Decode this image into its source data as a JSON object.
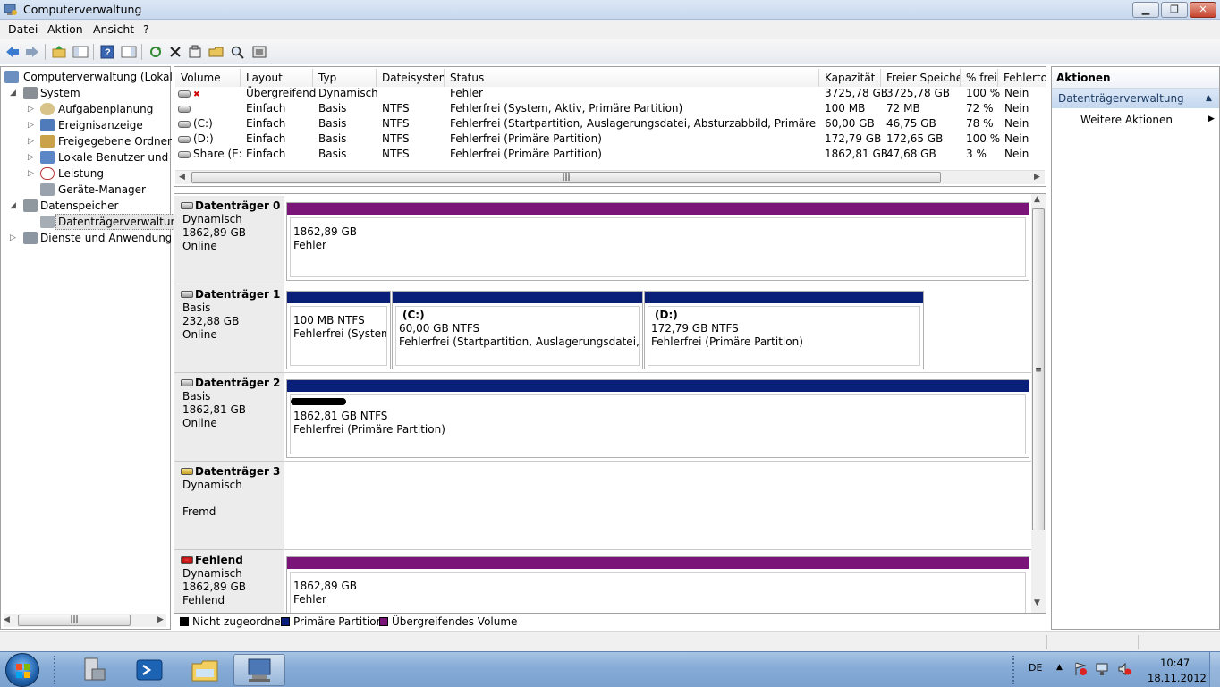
{
  "window": {
    "title": "Computerverwaltung"
  },
  "menu": [
    "Datei",
    "Aktion",
    "Ansicht",
    "?"
  ],
  "tree": [
    {
      "label": "Computerverwaltung (Lokal)"
    },
    {
      "label": "System"
    },
    {
      "label": "Aufgabenplanung"
    },
    {
      "label": "Ereignisanzeige"
    },
    {
      "label": "Freigegebene Ordner"
    },
    {
      "label": "Lokale Benutzer und Gru"
    },
    {
      "label": "Leistung"
    },
    {
      "label": "Geräte-Manager"
    },
    {
      "label": "Datenspeicher"
    },
    {
      "label": "Datenträgerverwaltung"
    },
    {
      "label": "Dienste und Anwendungen"
    }
  ],
  "volumes": {
    "columns": [
      "Volume",
      "Layout",
      "Typ",
      "Dateisystem",
      "Status",
      "Kapazität",
      "Freier Speicher",
      "% frei",
      "Fehlertol"
    ],
    "rows": [
      [
        "",
        "Übergreifend",
        "Dynamisch",
        "",
        "Fehler",
        "3725,78 GB",
        "3725,78 GB",
        "100 %",
        "Nein"
      ],
      [
        "",
        "Einfach",
        "Basis",
        "NTFS",
        "Fehlerfrei (System, Aktiv, Primäre Partition)",
        "100 MB",
        "72 MB",
        "72 %",
        "Nein"
      ],
      [
        "(C:)",
        "Einfach",
        "Basis",
        "NTFS",
        "Fehlerfrei (Startpartition, Auslagerungsdatei, Absturzabbild, Primäre Partition)",
        "60,00 GB",
        "46,75 GB",
        "78 %",
        "Nein"
      ],
      [
        "(D:)",
        "Einfach",
        "Basis",
        "NTFS",
        "Fehlerfrei (Primäre Partition)",
        "172,79 GB",
        "172,65 GB",
        "100 %",
        "Nein"
      ],
      [
        "Share (E:)",
        "Einfach",
        "Basis",
        "NTFS",
        "Fehlerfrei (Primäre Partition)",
        "1862,81 GB",
        "47,68 GB",
        "3 %",
        "Nein"
      ]
    ]
  },
  "disks": [
    {
      "name": "Datenträger 0",
      "type": "Dynamisch",
      "size": "1862,89 GB",
      "state": "Online"
    },
    {
      "name": "Datenträger 1",
      "type": "Basis",
      "size": "232,88 GB",
      "state": "Online"
    },
    {
      "name": "Datenträger 2",
      "type": "Basis",
      "size": "1862,81 GB",
      "state": "Online"
    },
    {
      "name": "Datenträger 3",
      "type": "Dynamisch",
      "size": "",
      "state": "Fremd"
    },
    {
      "name": "Fehlend",
      "type": "Dynamisch",
      "size": "1862,89 GB",
      "state": "Fehlend"
    }
  ],
  "partitions": {
    "d0": {
      "l1": "1862,89 GB",
      "l2": "Fehler"
    },
    "d1p0": {
      "l1": "100 MB NTFS",
      "l2": "Fehlerfrei (System, Aktiv, Primäre Partition)"
    },
    "d1p1": {
      "name": "(C:)",
      "l1": "60,00 GB NTFS",
      "l2": "Fehlerfrei (Startpartition, Auslagerungsdatei, Absturzabbild, Primäre Partition)"
    },
    "d1p2": {
      "name": "(D:)",
      "l1": "172,79 GB NTFS",
      "l2": "Fehlerfrei (Primäre Partition)"
    },
    "d2": {
      "l1": "1862,81 GB NTFS",
      "l2": "Fehlerfrei (Primäre Partition)"
    },
    "missing": {
      "l1": "1862,89 GB",
      "l2": "Fehler"
    }
  },
  "legend": [
    "Nicht zugeordnet",
    "Primäre Partition",
    "Übergreifendes Volume"
  ],
  "colors": {
    "unallocated": "#000000",
    "primary": "#0a1f7a",
    "spanned": "#7a1478"
  },
  "actions": {
    "header": "Aktionen",
    "section": "Datenträgerverwaltung",
    "more": "Weitere Aktionen"
  },
  "tray": {
    "lang": "DE",
    "time": "10:47",
    "date": "18.11.2012"
  }
}
